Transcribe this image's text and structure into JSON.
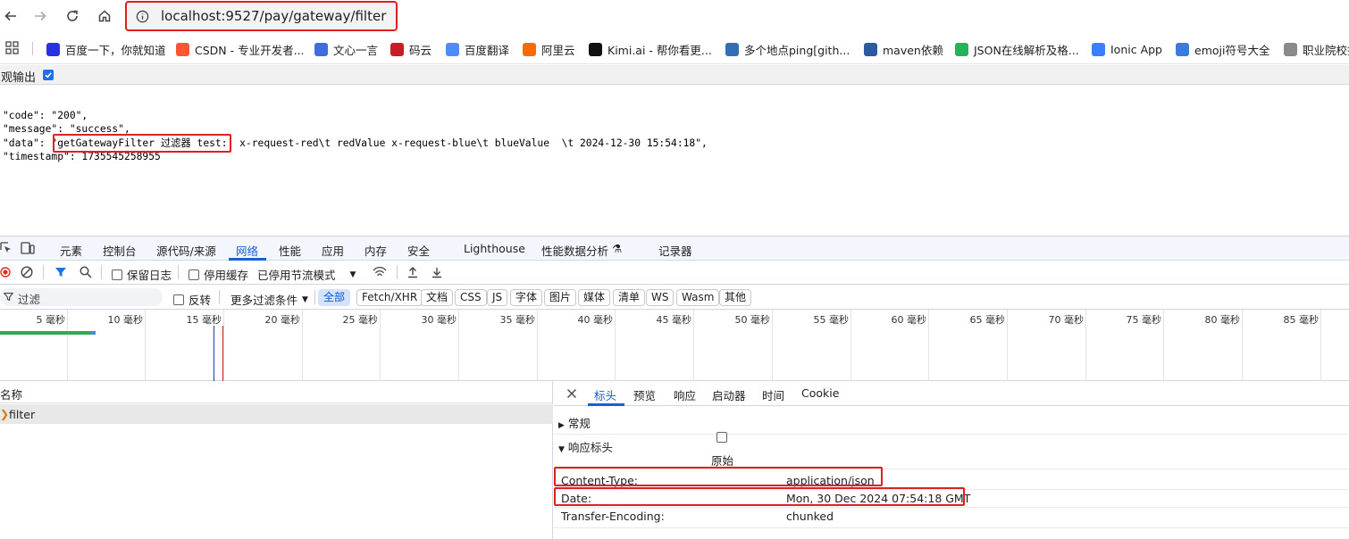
{
  "browser": {
    "url": "localhost:9527/pay/gateway/filter"
  },
  "bookmarks": [
    {
      "label": "百度一下，你就知道",
      "icon": "baidu-icon",
      "color": "#2932e1"
    },
    {
      "label": "CSDN - 专业开发者...",
      "icon": "csdn-icon",
      "color": "#fc5531"
    },
    {
      "label": "文心一言",
      "icon": "wenxin-icon",
      "color": "#3f6ce0"
    },
    {
      "label": "码云",
      "icon": "gitee-icon",
      "color": "#c71d23"
    },
    {
      "label": "百度翻译",
      "icon": "translate-icon",
      "color": "#4e8cf7"
    },
    {
      "label": "阿里云",
      "icon": "aliyun-icon",
      "color": "#ff6a00"
    },
    {
      "label": "Kimi.ai - 帮你看更...",
      "icon": "kimi-icon",
      "color": "#111111"
    },
    {
      "label": "多个地点ping[gith...",
      "icon": "ping-icon",
      "color": "#2f6fb5"
    },
    {
      "label": "maven依赖",
      "icon": "maven-icon",
      "color": "#2b5aa0"
    },
    {
      "label": "JSON在线解析及格...",
      "icon": "json-icon",
      "color": "#25b35a"
    },
    {
      "label": "Ionic App",
      "icon": "ionic-icon",
      "color": "#3880ff"
    },
    {
      "label": "emoji符号大全",
      "icon": "emoji-icon",
      "color": "#3b7be0"
    },
    {
      "label": "职业院校技",
      "icon": "school-icon",
      "color": "#8a8a8a"
    }
  ],
  "pretty_print": {
    "label": "观输出",
    "checked": true
  },
  "response_json": {
    "line1": "\"code\": \"200\",",
    "line2": "\"message\": \"success\",",
    "line3": "\"data\": \"getGatewayFilter 过滤器 test:  x-request-red\\t redValue x-request-blue\\t blueValue  \\t 2024-12-30 15:54:18\",",
    "line4": "\"timestamp\": 1735545258955"
  },
  "devtools": {
    "tabs": [
      "元素",
      "控制台",
      "源代码/来源",
      "网络",
      "性能",
      "应用",
      "内存",
      "安全",
      "Lighthouse",
      "性能数据分析",
      "记录器"
    ],
    "active_tab": "网络",
    "toolbar": {
      "preserve_log": "保留日志",
      "disable_cache": "停用缓存",
      "throttle": "已停用节流模式"
    },
    "filter": {
      "placeholder": "过滤",
      "invert": "反转",
      "more_filters": "更多过滤条件",
      "types": [
        "全部",
        "Fetch/XHR",
        "文档",
        "CSS",
        "JS",
        "字体",
        "图片",
        "媒体",
        "清单",
        "WS",
        "Wasm",
        "其他"
      ],
      "active_type": "全部"
    },
    "timeline_ticks": [
      "5 毫秒",
      "10 毫秒",
      "15 毫秒",
      "20 毫秒",
      "25 毫秒",
      "30 毫秒",
      "35 毫秒",
      "40 毫秒",
      "45 毫秒",
      "50 毫秒",
      "55 毫秒",
      "60 毫秒",
      "65 毫秒",
      "70 毫秒",
      "75 毫秒",
      "80 毫秒",
      "85 毫秒"
    ],
    "request_list": {
      "header": "名称",
      "rows": [
        "filter"
      ]
    },
    "detail": {
      "tabs": [
        "标头",
        "预览",
        "响应",
        "启动器",
        "时间",
        "Cookie"
      ],
      "active_tab": "标头",
      "general_section": "常规",
      "response_headers_section": "响应标头",
      "raw_label": "原始",
      "headers": [
        {
          "name": "Content-Type:",
          "value": "application/json"
        },
        {
          "name": "Date:",
          "value": "Mon, 30 Dec 2024 07:54:18 GMT"
        },
        {
          "name": "Transfer-Encoding:",
          "value": "chunked"
        }
      ]
    }
  },
  "colors": {
    "highlight": "#e02020",
    "accent": "#1a5fd0"
  }
}
